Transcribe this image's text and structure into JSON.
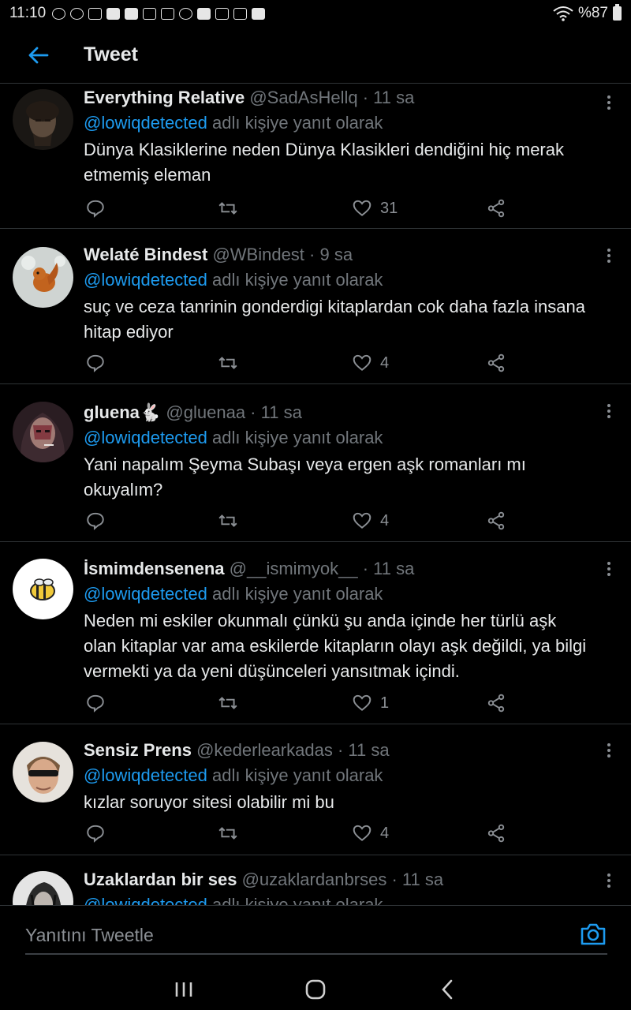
{
  "status_bar": {
    "time": "11:10",
    "battery": "%87",
    "icons": [
      "discord-icon",
      "discord-icon",
      "gmail-icon",
      "b-icon",
      "b-icon",
      "instagram-icon",
      "instagram-icon",
      "discord-icon",
      "video-icon",
      "gallery-icon",
      "download-done-icon",
      "bag-icon"
    ]
  },
  "header": {
    "title": "Tweet"
  },
  "replying_suffix": "adlı kişiye yanıt olarak",
  "tweets": [
    {
      "name": "Everything Relative",
      "handle": "@SadAsHellq",
      "time": "11 sa",
      "mention": "@lowiqdetected",
      "text": "Dünya Klasiklerine neden Dünya Klasikleri dendiğini hiç merak etmemiş eleman",
      "likes": "31"
    },
    {
      "name": "Welaté Bindest",
      "handle": "@WBindest",
      "time": "9 sa",
      "mention": "@lowiqdetected",
      "text": "suç ve ceza tanrinin gonderdigi kitaplardan cok daha fazla insana hitap ediyor",
      "likes": "4"
    },
    {
      "name": "gluena🐇",
      "handle": "@gluenaa",
      "time": "11 sa",
      "mention": "@lowiqdetected",
      "text": "Yani napalım Şeyma Subaşı veya ergen aşk romanları mı okuyalım?",
      "likes": "4"
    },
    {
      "name": "İsmimdensenena",
      "handle": "@__ismimyok__",
      "time": "11 sa",
      "mention": "@lowiqdetected",
      "text": "Neden mi eskiler okunmalı çünkü şu anda içinde her türlü aşk olan kitaplar var ama eskilerde kitapların olayı aşk değildi, ya bilgi vermekti ya da yeni düşünceleri yansıtmak içindi.",
      "likes": "1"
    },
    {
      "name": "Sensiz Prens",
      "handle": "@kederlearkadas",
      "time": "11 sa",
      "mention": "@lowiqdetected",
      "text": "kızlar soruyor sitesi olabilir mi bu",
      "likes": "4"
    },
    {
      "name": "Uzaklardan bir ses",
      "handle": "@uzaklardanbrses",
      "time": "11 sa",
      "mention": "@lowiqdetected",
      "text": "",
      "likes": ""
    }
  ],
  "reply_bar": {
    "placeholder": "Yanıtını Tweetle"
  },
  "colors": {
    "accent": "#1d9bf0",
    "background": "#000000",
    "divider": "#2f3336",
    "muted": "#71767b"
  }
}
